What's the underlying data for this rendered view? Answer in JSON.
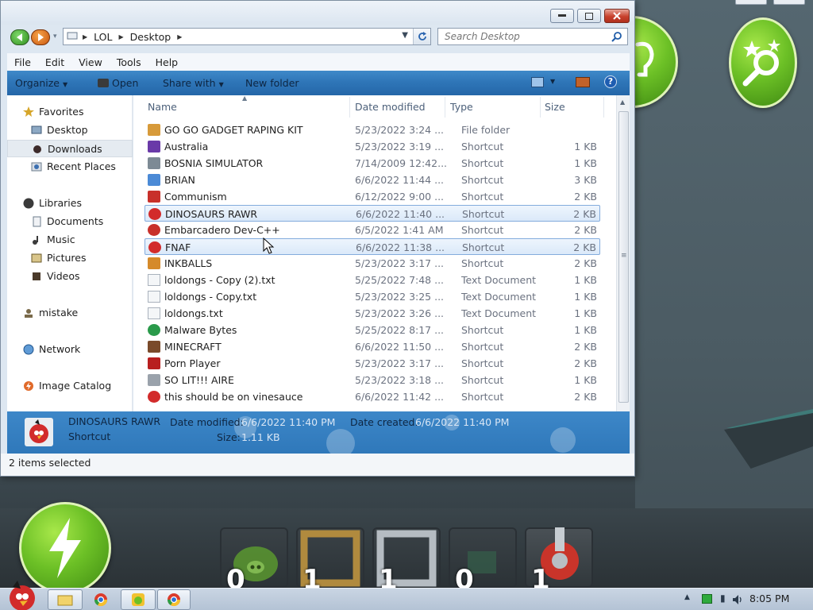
{
  "window": {
    "breadcrumb": [
      "LOL",
      "Desktop"
    ],
    "search_placeholder": "Search Desktop"
  },
  "menu": [
    "File",
    "Edit",
    "View",
    "Tools",
    "Help"
  ],
  "toolbar": {
    "organize": "Organize",
    "open": "Open",
    "share_with": "Share with",
    "new_folder": "New folder"
  },
  "nav": {
    "favorites": "Favorites",
    "desktop": "Desktop",
    "downloads": "Downloads",
    "recent_places": "Recent Places",
    "libraries": "Libraries",
    "documents": "Documents",
    "music": "Music",
    "pictures": "Pictures",
    "videos": "Videos",
    "mistake": "mistake",
    "network": "Network",
    "image_catalog": "Image Catalog"
  },
  "columns": {
    "name": "Name",
    "date_modified": "Date modified",
    "type": "Type",
    "size": "Size"
  },
  "files": [
    {
      "name": "GO GO GADGET RAPING KIT",
      "date": "5/23/2022 3:24 ...",
      "type": "File folder",
      "size": "",
      "icon": "folder-icon",
      "selected": false
    },
    {
      "name": "Australia",
      "date": "5/23/2022 3:19 ...",
      "type": "Shortcut",
      "size": "1 KB",
      "icon": "spider-icon",
      "selected": false
    },
    {
      "name": "BOSNIA SIMULATOR",
      "date": "7/14/2009 12:42...",
      "type": "Shortcut",
      "size": "1 KB",
      "icon": "gear-icon",
      "selected": false
    },
    {
      "name": "BRIAN",
      "date": "6/6/2022 11:44 ...",
      "type": "Shortcut",
      "size": "3 KB",
      "icon": "bird-icon",
      "selected": false
    },
    {
      "name": "Communism",
      "date": "6/12/2022 9:00 ...",
      "type": "Shortcut",
      "size": "2 KB",
      "icon": "flag-icon",
      "selected": false
    },
    {
      "name": "DINOSAURS RAWR",
      "date": "6/6/2022 11:40 ...",
      "type": "Shortcut",
      "size": "2 KB",
      "icon": "angry-bird-icon",
      "selected": true
    },
    {
      "name": "Embarcadero Dev-C++",
      "date": "6/5/2022 1:41 AM",
      "type": "Shortcut",
      "size": "2 KB",
      "icon": "devcpp-icon",
      "selected": false
    },
    {
      "name": "FNAF",
      "date": "6/6/2022 11:38 ...",
      "type": "Shortcut",
      "size": "2 KB",
      "icon": "angry-bird-icon",
      "selected": true
    },
    {
      "name": "INKBALLS",
      "date": "5/23/2022 3:17 ...",
      "type": "Shortcut",
      "size": "2 KB",
      "icon": "inkball-icon",
      "selected": false
    },
    {
      "name": "loldongs - Copy (2).txt",
      "date": "5/25/2022 7:48 ...",
      "type": "Text Document",
      "size": "1 KB",
      "icon": "text-file-icon",
      "selected": false
    },
    {
      "name": "loldongs - Copy.txt",
      "date": "5/23/2022 3:25 ...",
      "type": "Text Document",
      "size": "1 KB",
      "icon": "text-file-icon",
      "selected": false
    },
    {
      "name": "loldongs.txt",
      "date": "5/23/2022 3:26 ...",
      "type": "Text Document",
      "size": "1 KB",
      "icon": "text-file-icon",
      "selected": false
    },
    {
      "name": "Malware Bytes",
      "date": "5/25/2022 8:17 ...",
      "type": "Shortcut",
      "size": "1 KB",
      "icon": "shield-icon",
      "selected": false
    },
    {
      "name": "MINECRAFT",
      "date": "6/6/2022 11:50 ...",
      "type": "Shortcut",
      "size": "2 KB",
      "icon": "minecraft-icon",
      "selected": false
    },
    {
      "name": "Porn Player",
      "date": "5/23/2022 3:17 ...",
      "type": "Shortcut",
      "size": "2 KB",
      "icon": "flash-icon",
      "selected": false
    },
    {
      "name": "SO LIT!!! AIRE",
      "date": "5/23/2022 3:18 ...",
      "type": "Shortcut",
      "size": "1 KB",
      "icon": "app-icon",
      "selected": false
    },
    {
      "name": "this should be on vinesauce",
      "date": "6/6/2022 11:42 ...",
      "type": "Shortcut",
      "size": "2 KB",
      "icon": "angry-bird-icon",
      "selected": false
    }
  ],
  "details": {
    "name": "DINOSAURS RAWR",
    "type": "Shortcut",
    "date_modified_label": "Date modified:",
    "date_modified": "6/6/2022 11:40 PM",
    "date_created_label": "Date created:",
    "date_created": "6/6/2022 11:40 PM",
    "size_label": "Size:",
    "size": "1.11 KB"
  },
  "status": {
    "text": "2 items selected"
  },
  "game": {
    "tool_counts": [
      "0",
      "1",
      "1",
      "0",
      "1"
    ]
  },
  "taskbar": {
    "clock": "8:05 PM"
  },
  "colors": {
    "selection_border": "#84acdd",
    "command_bar": "#2f76b8",
    "game_button_green": "#6cc026"
  }
}
